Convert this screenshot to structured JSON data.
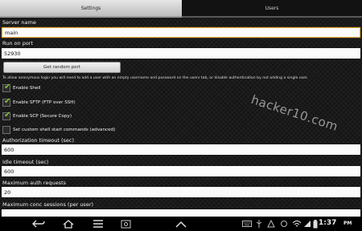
{
  "tabs": [
    {
      "label": "Settings",
      "active": true
    },
    {
      "label": "Users",
      "active": false
    }
  ],
  "form": {
    "server_name_label": "Server name",
    "server_name_value": "main",
    "port_label": "Run on port",
    "port_value": "52930",
    "random_port_button": "Get random port",
    "anon_note": "To allow anonymous login you will need to add a user with an empty username and password on the users tab, or disable authentication by not adding a single user.",
    "checkboxes": [
      {
        "label": "Enable Shell",
        "checked": true
      },
      {
        "label": "Enable SFTP (FTP over SSH)",
        "checked": true
      },
      {
        "label": "Enable SCP (Secure Copy)",
        "checked": true
      },
      {
        "label": "Set custom shell start commands (advanced)",
        "checked": false
      }
    ],
    "auth_timeout_label": "Authorization timeout (sec)",
    "auth_timeout_value": "600",
    "idle_timeout_label": "Idle timeout (sec)",
    "idle_timeout_value": "600",
    "max_auth_label": "Maximum auth requests",
    "max_auth_value": "20",
    "max_conc_label": "Maximum conc sessions (per user)"
  },
  "watermark": "hacker10.com",
  "statusbar": {
    "time": "1:37",
    "ampm": "PM"
  },
  "icons": [
    "back-icon",
    "home-icon",
    "recent-apps-icon",
    "screenshot-icon",
    "up-arrow-icon",
    "keyboard-icon",
    "usb-icon",
    "notification-icon",
    "sync-icon",
    "wifi-icon",
    "signal-icon",
    "battery-icon"
  ],
  "colors": {
    "accent_focus": "#e8a53a",
    "check_tick": "#7fc23b"
  }
}
